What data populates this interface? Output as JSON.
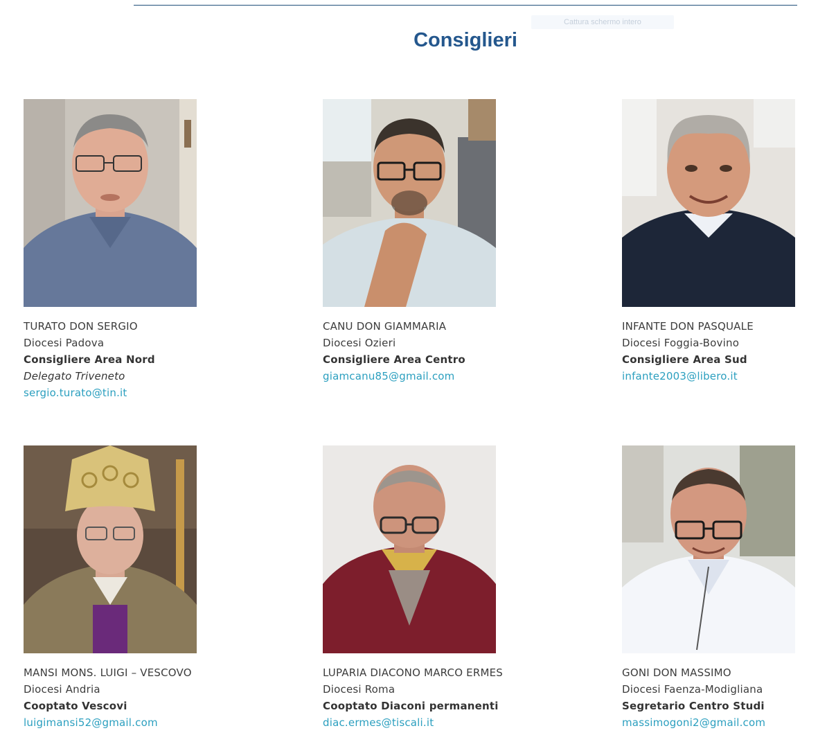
{
  "header": {
    "capture_label": "Cattura schermo intero",
    "title": "Consiglieri"
  },
  "colors": {
    "title": "#24578d",
    "email": "#2b9fbf",
    "rule": "#1f4e79"
  },
  "members": [
    {
      "name": "TURATO DON SERGIO",
      "diocese": "Diocesi Padova",
      "role": "Consigliere Area Nord",
      "extra": "Delegato Triveneto",
      "email": "sergio.turato@tin.it",
      "photo_alt": "portrait-man-glasses-grey-shirt"
    },
    {
      "name": "CANU DON GIAMMARIA",
      "diocese": "Diocesi Ozieri",
      "role": "Consigliere Area Centro",
      "extra": "",
      "email": "giamcanu85@gmail.com",
      "photo_alt": "portrait-man-glasses-hand-on-chin"
    },
    {
      "name": "INFANTE DON PASQUALE",
      "diocese": "Diocesi Foggia-Bovino",
      "role": "Consigliere Area Sud",
      "extra": "",
      "email": "infante2003@libero.it",
      "photo_alt": "portrait-smiling-man-dark-sweater"
    },
    {
      "name": "MANSI MONS. LUIGI – VESCOVO",
      "diocese": "Diocesi Andria",
      "role": "Cooptato Vescovi",
      "extra": "",
      "email": "luigimansi52@gmail.com",
      "photo_alt": "portrait-bishop-mitre"
    },
    {
      "name": "LUPARIA DIACONO MARCO ERMES",
      "diocese": "Diocesi Roma",
      "role": "Cooptato Diaconi permanenti",
      "extra": "",
      "email": "diac.ermes@tiscali.it",
      "photo_alt": "portrait-man-red-cardigan"
    },
    {
      "name": "GONI DON MASSIMO",
      "diocese": "Diocesi Faenza-Modigliana",
      "role": "Segretario Centro Studi",
      "extra": "",
      "email": "massimogoni2@gmail.com",
      "photo_alt": "portrait-man-glasses-white-polo"
    }
  ]
}
